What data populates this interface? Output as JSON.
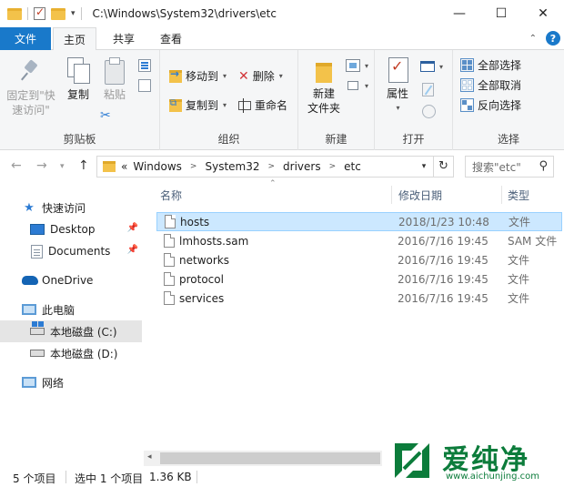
{
  "window": {
    "title": "C:\\Windows\\System32\\drivers\\etc",
    "controls": {
      "minimize": "—",
      "maximize": "☐",
      "close": "✕"
    }
  },
  "quick_access_toolbar": {
    "dropdown": "▾"
  },
  "ribbon_tabs": [
    {
      "label": "文件",
      "active": false
    },
    {
      "label": "主页",
      "active": true
    },
    {
      "label": "共享",
      "active": false
    },
    {
      "label": "查看",
      "active": false
    }
  ],
  "ribbon": {
    "clipboard": {
      "label": "剪贴板",
      "pin_quick_access": "固定到\"快速访问\"",
      "copy": "复制",
      "paste": "粘贴"
    },
    "organize": {
      "label": "组织",
      "move_to": "移动到",
      "copy_to": "复制到",
      "delete": "删除",
      "rename": "重命名"
    },
    "new": {
      "label": "新建",
      "new_folder": "新建\n文件夹"
    },
    "open": {
      "label": "打开",
      "properties": "属性"
    },
    "select": {
      "label": "选择",
      "select_all": "全部选择",
      "select_none": "全部取消",
      "invert_selection": "反向选择"
    }
  },
  "address_bar": {
    "overflow": "«",
    "crumbs": [
      "Windows",
      "System32",
      "drivers",
      "etc"
    ],
    "search_placeholder": "搜索\"etc\""
  },
  "nav_pane": {
    "quick_access": "快速访问",
    "desktop": "Desktop",
    "documents": "Documents",
    "onedrive": "OneDrive",
    "this_pc": "此电脑",
    "local_disk_c": "本地磁盘 (C:)",
    "local_disk_d": "本地磁盘 (D:)",
    "network": "网络"
  },
  "file_list": {
    "columns": {
      "name": "名称",
      "date": "修改日期",
      "type": "类型"
    },
    "rows": [
      {
        "name": "hosts",
        "date": "2018/1/23 10:48",
        "type": "文件",
        "selected": true
      },
      {
        "name": "lmhosts.sam",
        "date": "2016/7/16 19:45",
        "type": "SAM 文件",
        "selected": false
      },
      {
        "name": "networks",
        "date": "2016/7/16 19:45",
        "type": "文件",
        "selected": false
      },
      {
        "name": "protocol",
        "date": "2016/7/16 19:45",
        "type": "文件",
        "selected": false
      },
      {
        "name": "services",
        "date": "2016/7/16 19:45",
        "type": "文件",
        "selected": false
      }
    ]
  },
  "status_bar": {
    "item_count": "5 个项目",
    "selected": "选中 1 个项目",
    "size": "1.36 KB"
  },
  "watermark": {
    "brand": "爱纯净",
    "url": "www.aichunjing.com"
  },
  "colors": {
    "accent": "#1979ca",
    "selection_bg": "#cce8ff",
    "watermark_green": "#0c7c3b"
  }
}
